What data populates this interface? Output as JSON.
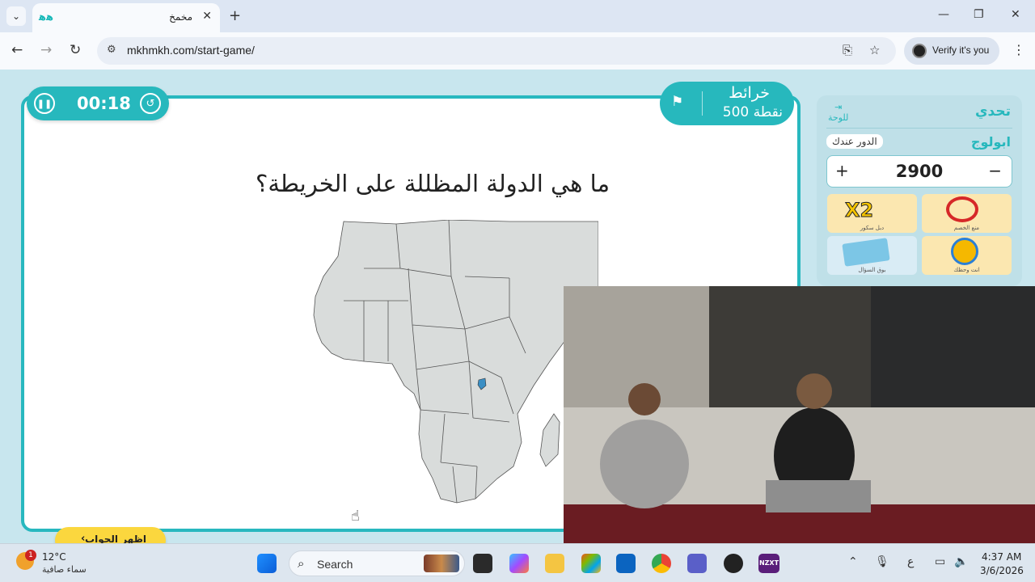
{
  "browser": {
    "tab_title": "مخمخ",
    "url": "mkhmkh.com/start-game/",
    "verify_label": "Verify it's you"
  },
  "game": {
    "timer": "00:18",
    "category_name": "خرائط",
    "category_points": "500 نقطة",
    "question": "ما هي الدولة المظللة على الخريطة؟",
    "reveal_label": "اظهر الجواب",
    "highlight_color": "#3b8fc4"
  },
  "side": {
    "title": "تحدي",
    "exit_label": "للوحة",
    "player_name": "ابولوج",
    "turn_label": "الدور عندك",
    "score": "2900",
    "powerups": [
      {
        "label": "دبل سكور",
        "icon": "x2-icon"
      },
      {
        "label": "منع الخصم",
        "icon": "block-opponent-icon"
      },
      {
        "label": "بوق السؤال",
        "icon": "cards-icon"
      },
      {
        "label": "انت وحظك",
        "icon": "wheel-icon"
      }
    ]
  },
  "taskbar": {
    "weather_temp": "12°C",
    "weather_desc": "سماء صافية",
    "weather_badge": "1",
    "search_placeholder": "Search",
    "ime_label": "ع",
    "time": "4:37 AM",
    "date": "3/6/2026",
    "nzxt_label": "NZXT"
  },
  "colors": {
    "accent": "#27b8bd",
    "button_yellow": "#fbd73e"
  }
}
